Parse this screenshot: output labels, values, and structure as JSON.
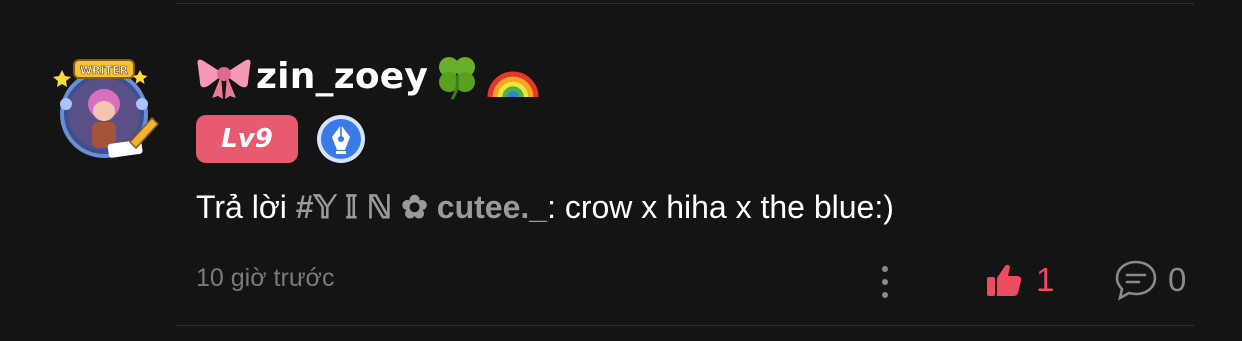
{
  "comment": {
    "username": "zin_zoey",
    "username_prefix_icon": "ribbon-bow-emoji",
    "username_suffix_icons": [
      "four-leaf-clover-emoji",
      "rainbow-emoji"
    ],
    "avatar_frame_text": "WRITER",
    "level_badge": "Lv9",
    "reply_prefix": "Trả lời",
    "reply_mention": "#𝕐 𝕀 ℕ ✿ cutee._",
    "reply_text": ": crow x hiha x the blue:)",
    "timestamp": "10 giờ trước",
    "like_count": "1",
    "comment_count": "0"
  },
  "colors": {
    "background": "#141414",
    "level_badge": "#e85a6f",
    "like": "#ee4b60",
    "muted_text": "#7a7a7a",
    "mention": "#9a9a9a"
  }
}
